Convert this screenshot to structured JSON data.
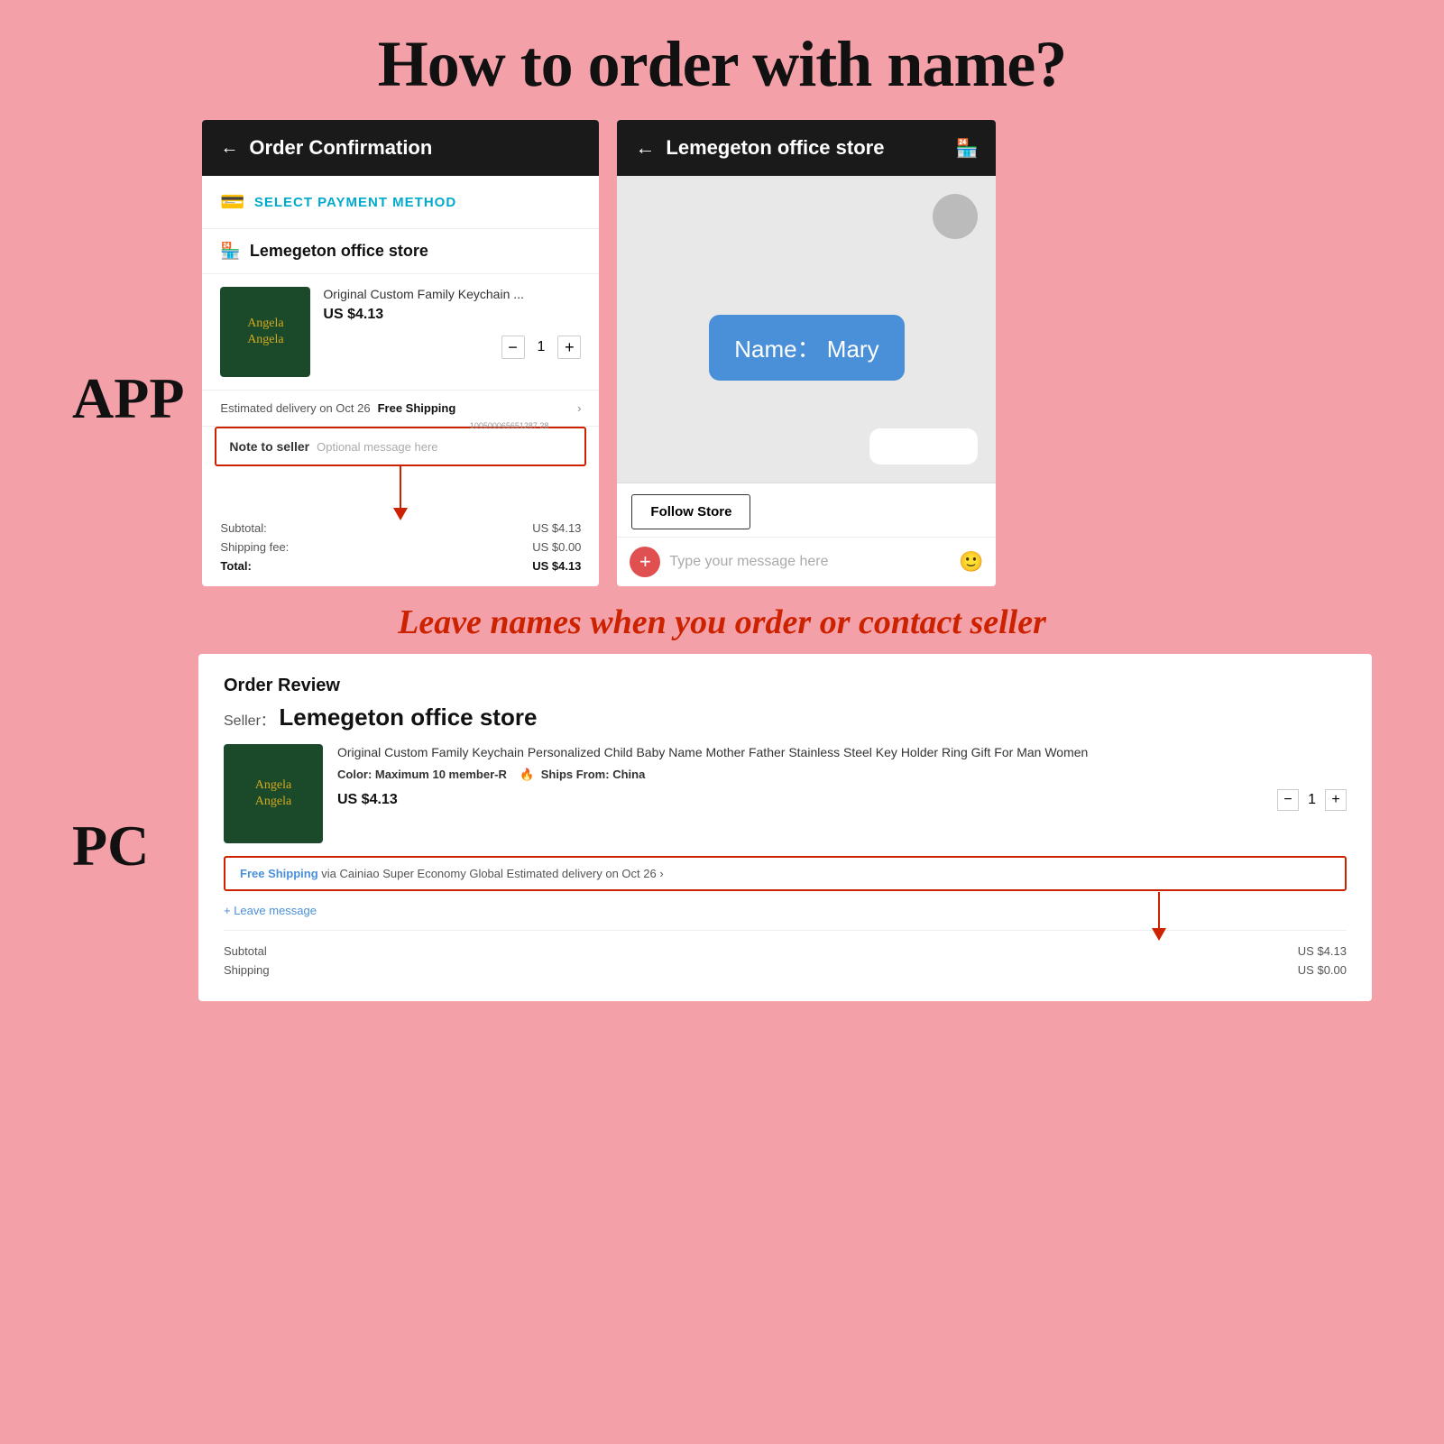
{
  "page": {
    "title": "How to order with name?",
    "bg_color": "#f4a0a8"
  },
  "app_section": {
    "label": "APP",
    "phone": {
      "header": {
        "back": "←",
        "title": "Order Confirmation"
      },
      "payment": {
        "icon": "💳",
        "text": "SELECT PAYMENT METHOD"
      },
      "store": {
        "icon": "🏪",
        "name": "Lemegeton office store"
      },
      "product": {
        "name_line1": "Angela",
        "name_line2": "Angela",
        "title": "Original Custom Family Keychain ...",
        "price": "US $4.13",
        "qty": "1"
      },
      "delivery": {
        "text": "Estimated delivery on Oct 26",
        "shipping": "Free Shipping"
      },
      "note": {
        "label": "Note to seller",
        "placeholder": "Optional message here",
        "barcode": "100500065651287 28"
      },
      "totals": {
        "subtotal_label": "Subtotal:",
        "subtotal_value": "US $4.13",
        "shipping_label": "Shipping fee:",
        "shipping_value": "US $0.00",
        "total_label": "Total:",
        "total_value": "US $4.13"
      }
    },
    "chat": {
      "header": {
        "back": "←",
        "title": "Lemegeton office store",
        "icon": "🏪"
      },
      "message_bubble": "Name：  Mary",
      "follow_store": "Follow Store",
      "input_placeholder": "Type your message here",
      "plus_btn": "+"
    }
  },
  "middle_label": "Leave names when you order or contact seller",
  "pc_section": {
    "label": "PC",
    "screen": {
      "order_review": "Order Review",
      "seller_prefix": "Seller：",
      "seller_name": "Lemegeton office store",
      "product": {
        "name_line1": "Angela",
        "name_line2": "Angela",
        "title": "Original Custom Family Keychain Personalized Child Baby Name Mother Father Stainless Steel Key Holder Ring Gift For Man Women",
        "color_label": "Color:",
        "color_value": "Maximum 10 member-R",
        "ships_label": "Ships From:",
        "ships_value": "China",
        "price": "US $4.13",
        "qty": "1"
      },
      "shipping_box": "Free Shipping via Cainiao Super Economy Global  Estimated delivery on Oct 26  >",
      "leave_message": "+ Leave message",
      "totals": {
        "subtotal_label": "Subtotal",
        "subtotal_value": "US $4.13",
        "shipping_label": "Shipping",
        "shipping_value": "US $0.00"
      }
    }
  }
}
